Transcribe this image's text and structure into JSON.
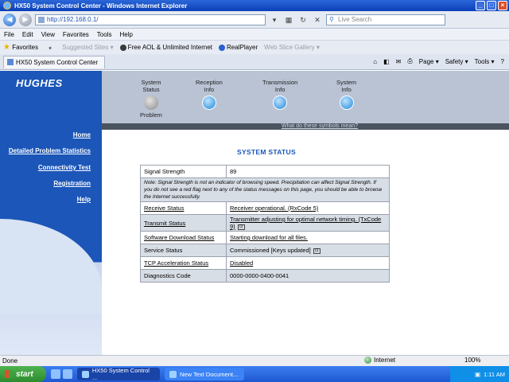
{
  "window": {
    "title": "HX50 System Control Center - Windows Internet Explorer"
  },
  "browser": {
    "address": "http://192.168.0.1/",
    "search_placeholder": "Live Search",
    "menu": [
      "File",
      "Edit",
      "View",
      "Favorites",
      "Tools",
      "Help"
    ],
    "favorites_label": "Favorites",
    "favorites_links": [
      "Suggested Sites ▾",
      "Free AOL & Unlimited Internet",
      "RealPlayer",
      "Web Slice Gallery ▾"
    ],
    "tab_title": "HX50 System Control Center",
    "commands": [
      "Page ▾",
      "Safety ▾",
      "Tools ▾"
    ]
  },
  "header": {
    "logo": "HUGHES",
    "nav": [
      {
        "line1": "System",
        "line2": "Status",
        "line3": "Problem"
      },
      {
        "line1": "Reception",
        "line2": "Info"
      },
      {
        "line1": "Transmission",
        "line2": "Info"
      },
      {
        "line1": "System",
        "line2": "Info"
      }
    ],
    "strip_link": "What do these symbols mean?"
  },
  "sidebar": {
    "links": [
      "Home",
      "Detailed Problem Statistics",
      "Connectivity Test",
      "Registration",
      "Help"
    ]
  },
  "main": {
    "title": "SYSTEM STATUS",
    "signal_label": "Signal Strength",
    "signal_value": "89",
    "note": "Note: Signal Strength is not an indicator of browsing speed. Precipitation can affect Signal Strength. If you do not see a red flag next to any of the status messages on this page, you should be able to browse the Internet successfully.",
    "rows": [
      {
        "label": "Receive Status",
        "value": "Receiver operational. (RxCode 5)"
      },
      {
        "label": "Transmit Status",
        "value": "Transmitter adjusting for optimal network timing. (TxCode 9)"
      },
      {
        "label": "Software Download Status",
        "value": "Starting download for all files."
      },
      {
        "label": "Service Status",
        "value": "Commissioned [Keys updated]"
      },
      {
        "label": "TCP Acceleration Status",
        "value": "Disabled"
      },
      {
        "label": "Diagnostics Code",
        "value": "0000-0000-0400-0041"
      }
    ]
  },
  "statusbar": {
    "left": "Done",
    "zone": "Internet",
    "zoom": "100%"
  },
  "taskbar": {
    "start": "start",
    "tasks": [
      "HX50 System Control ...",
      "New Text Document..."
    ],
    "clock": "1:11 AM"
  },
  "colors": {
    "hughes_blue": "#1b56b8",
    "header_grey": "#b9c3d4",
    "table_shade": "#d8dee6"
  }
}
